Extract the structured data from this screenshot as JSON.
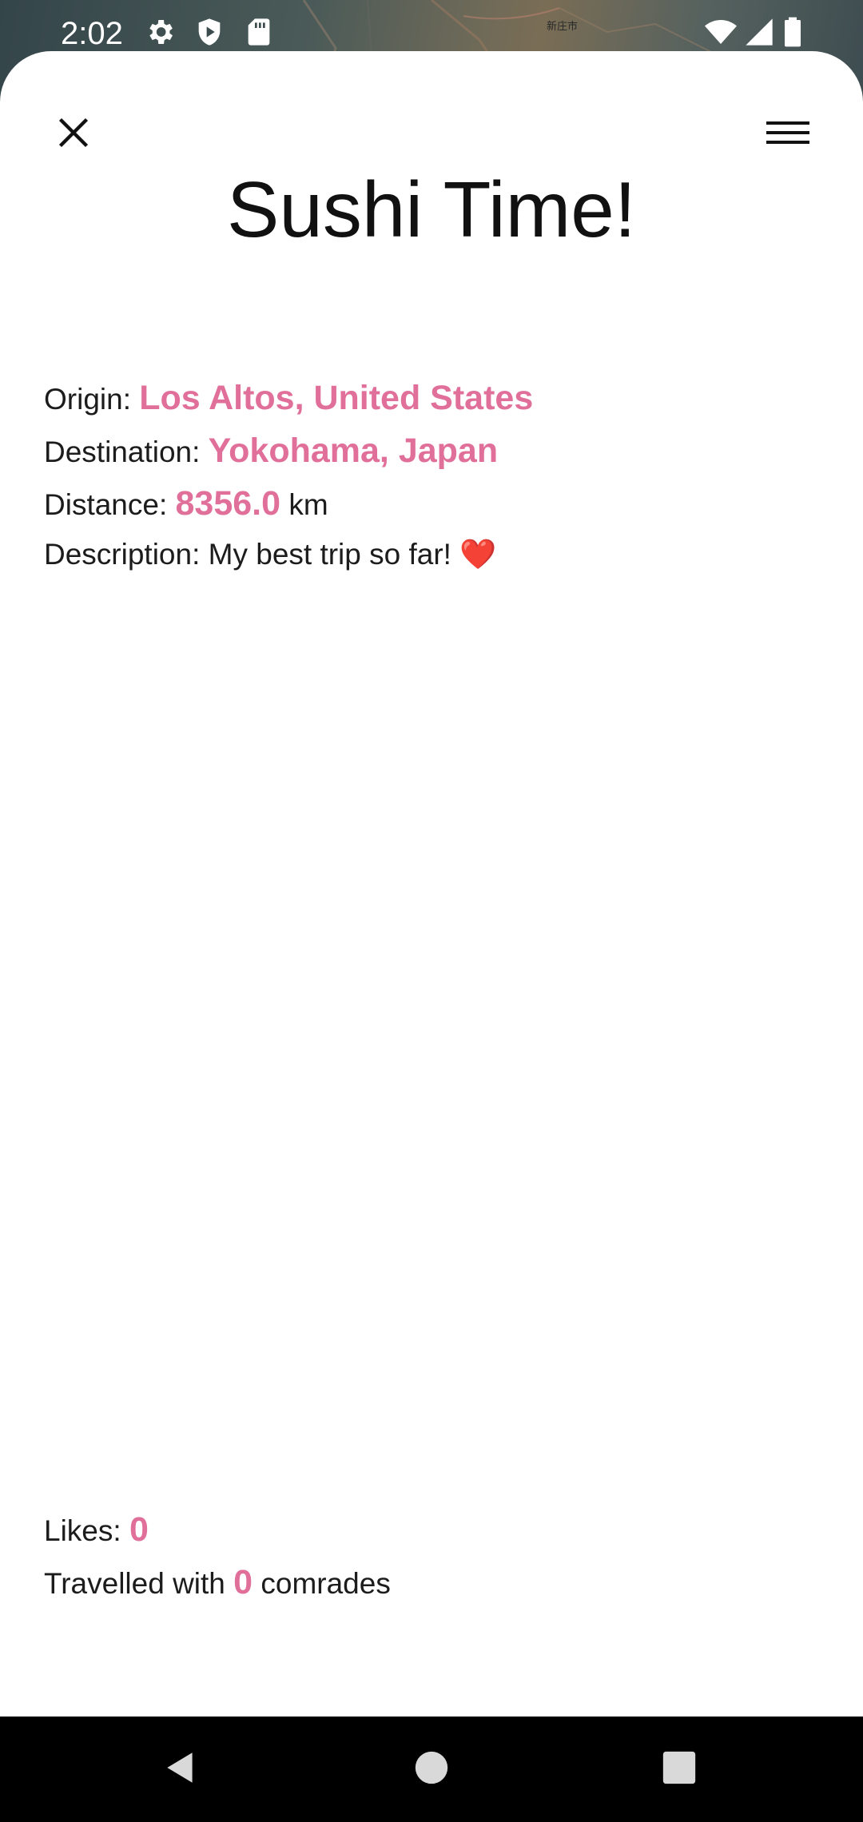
{
  "status_bar": {
    "time": "2:02",
    "left_icons": [
      "gear-icon",
      "shield-play-icon",
      "sd-card-icon"
    ],
    "right_icons": [
      "wifi-icon",
      "signal-icon",
      "battery-icon"
    ]
  },
  "map": {
    "place_label": "新庄市"
  },
  "sheet": {
    "close_icon": "close-icon",
    "menu_icon": "hamburger-menu-icon",
    "title": "Sushi Time!"
  },
  "trip": {
    "origin_label": "Origin:",
    "origin_value": "Los Altos, United States",
    "destination_label": "Destination:",
    "destination_value": "Yokohama, Japan",
    "distance_label": "Distance:",
    "distance_value": "8356.0",
    "distance_unit": "km",
    "description_label": "Description:",
    "description_value": "My best trip so far! ❤️"
  },
  "stats": {
    "likes_label": "Likes:",
    "likes_value": "0",
    "comrades_prefix": "Travelled with",
    "comrades_value": "0",
    "comrades_suffix": "comrades"
  },
  "nav_bar": {
    "icons": [
      "back-icon",
      "home-icon",
      "recents-icon"
    ]
  },
  "colors": {
    "accent": "#e0709a",
    "text": "#1c1c1c",
    "sheet_bg": "#ffffff",
    "nav_bg": "#000000"
  }
}
